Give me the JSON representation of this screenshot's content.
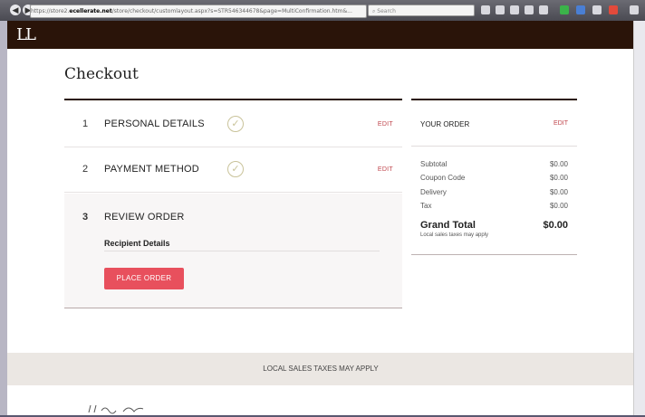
{
  "browser": {
    "url_prefix": "https://store2.",
    "url_host": "ecellerate.net",
    "url_rest": "/store/checkout/customlayout.aspx?s=STR546344678&page=MultiConfirmation.htm&...",
    "search_placeholder": "Search"
  },
  "site": {
    "logo": "LL"
  },
  "checkout": {
    "title": "Checkout",
    "steps": [
      {
        "number": "1",
        "label": "PERSONAL DETAILS",
        "check": "✓",
        "edit": "EDIT"
      },
      {
        "number": "2",
        "label": "PAYMENT METHOD",
        "check": "✓",
        "edit": "EDIT"
      },
      {
        "number": "3",
        "label": "REVIEW ORDER"
      }
    ],
    "recipient_heading": "Recipient Details",
    "place_order": "PLACE ORDER"
  },
  "summary": {
    "heading": "YOUR ORDER",
    "edit": "EDIT",
    "rows": [
      {
        "label": "Subtotal",
        "value": "$0.00"
      },
      {
        "label": "Coupon Code",
        "value": "$0.00"
      },
      {
        "label": "Delivery",
        "value": "$0.00"
      },
      {
        "label": "Tax",
        "value": "$0.00"
      }
    ],
    "grand_total_label": "Grand Total",
    "grand_total_value": "$0.00",
    "tax_note": "Local sales taxes may apply"
  },
  "footer": {
    "band_text": "LOCAL SALES TAXES MAY APPLY"
  }
}
